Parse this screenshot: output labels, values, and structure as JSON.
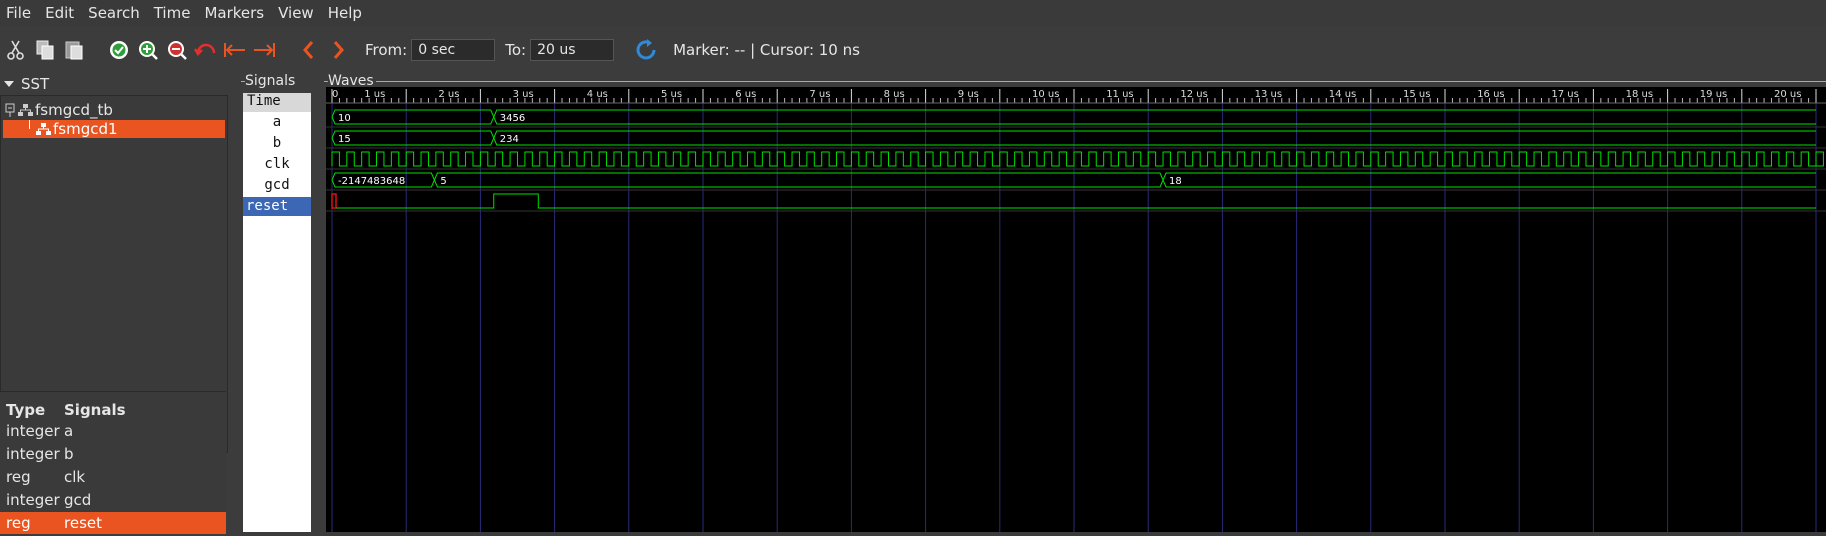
{
  "menu": [
    "File",
    "Edit",
    "Search",
    "Time",
    "Markers",
    "View",
    "Help"
  ],
  "toolbar": {
    "from_label": "From:",
    "from_value": "0 sec",
    "to_label": "To:",
    "to_value": "20 us",
    "marker_text": "Marker: -- | Cursor: 10 ns",
    "icons": [
      "cut-icon",
      "copy-icon",
      "paste-icon",
      "zoom-fit-icon",
      "zoom-in-icon",
      "zoom-out-icon",
      "undo-zoom-icon",
      "zoom-to-start-icon",
      "zoom-to-end-icon",
      "prev-edge-icon",
      "next-edge-icon",
      "reload-icon"
    ]
  },
  "sst": {
    "title": "SST",
    "tree": [
      {
        "label": "fsmgcd_tb"
      },
      {
        "label": "fsmgcd1"
      }
    ],
    "signal_table": {
      "headers": [
        "Type",
        "Signals"
      ],
      "rows": [
        {
          "type": "integer",
          "name": "a"
        },
        {
          "type": "integer",
          "name": "b"
        },
        {
          "type": "reg",
          "name": "clk"
        },
        {
          "type": "integer",
          "name": "gcd"
        },
        {
          "type": "reg",
          "name": "reset"
        }
      ]
    }
  },
  "signals_panel": {
    "title": "Signals",
    "time_header": "Time",
    "names": [
      "a",
      "b",
      "clk",
      "gcd",
      "reset"
    ]
  },
  "waves_panel": {
    "title": "Waves",
    "time_ticks": [
      "0",
      "1 us",
      "2 us",
      "3 us",
      "4 us",
      "5 us",
      "6 us",
      "7 us",
      "8 us",
      "9 us",
      "10 us",
      "11 us",
      "12 us",
      "13 us",
      "14 us",
      "15 us",
      "16 us",
      "17 us",
      "18 us",
      "19 us",
      "20 us"
    ],
    "time_range_us": [
      0,
      20
    ],
    "traces": [
      {
        "name": "a",
        "kind": "bus",
        "segments": [
          {
            "from_us": 0,
            "to_us": 2.18,
            "value": "10"
          },
          {
            "from_us": 2.18,
            "to_us": 20,
            "value": "3456"
          }
        ]
      },
      {
        "name": "b",
        "kind": "bus",
        "segments": [
          {
            "from_us": 0,
            "to_us": 2.18,
            "value": "15"
          },
          {
            "from_us": 2.18,
            "to_us": 20,
            "value": "234"
          }
        ]
      },
      {
        "name": "clk",
        "kind": "clock",
        "period_us": 0.2
      },
      {
        "name": "gcd",
        "kind": "bus",
        "segments": [
          {
            "from_us": 0,
            "to_us": 1.38,
            "value": "-2147483648"
          },
          {
            "from_us": 1.38,
            "to_us": 11.2,
            "value": "5"
          },
          {
            "from_us": 11.2,
            "to_us": 20,
            "value": "18"
          }
        ]
      },
      {
        "name": "reset",
        "kind": "bit",
        "pulses": [
          {
            "from_us": 2.18,
            "to_us": 2.78
          }
        ]
      }
    ]
  },
  "colors": {
    "accent": "#e95420",
    "wave_green": "#00e000",
    "grid_blue": "#2a2a7a",
    "selected_signal": "#3b67b5"
  }
}
